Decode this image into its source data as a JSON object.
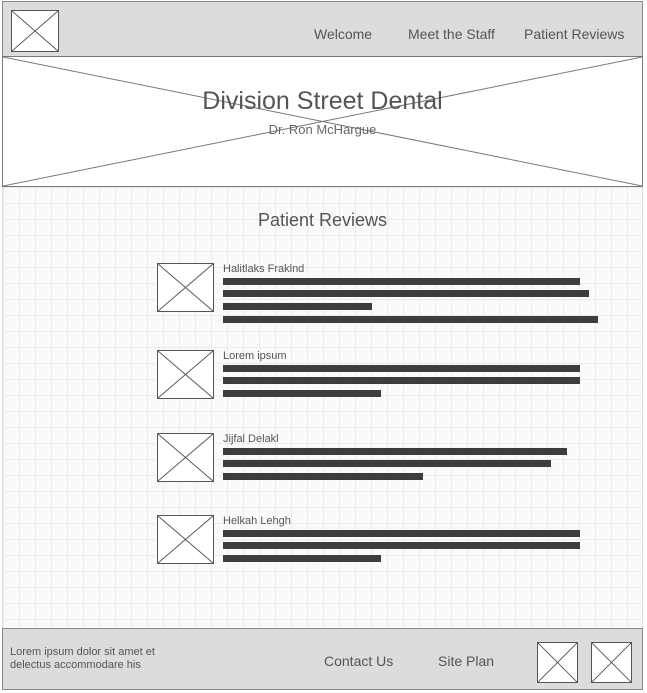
{
  "header": {
    "nav": [
      "Welcome",
      "Meet the Staff",
      "Patient Reviews"
    ]
  },
  "hero": {
    "title": "Division Street Dental",
    "subtitle": "Dr. Ron McHargue"
  },
  "main": {
    "title": "Patient Reviews",
    "reviews": [
      {
        "name": "Halitlaks Fraklnd",
        "lines": 4
      },
      {
        "name": "Lorem ipsum",
        "lines": 3
      },
      {
        "name": "Jijfal Delakl",
        "lines": 3
      },
      {
        "name": "Helkah Lehgh",
        "lines": 3
      }
    ]
  },
  "footer": {
    "text": "Lorem ipsum dolor sit amet et delectus accommodare his",
    "links": [
      "Contact Us",
      "Site Plan"
    ]
  }
}
